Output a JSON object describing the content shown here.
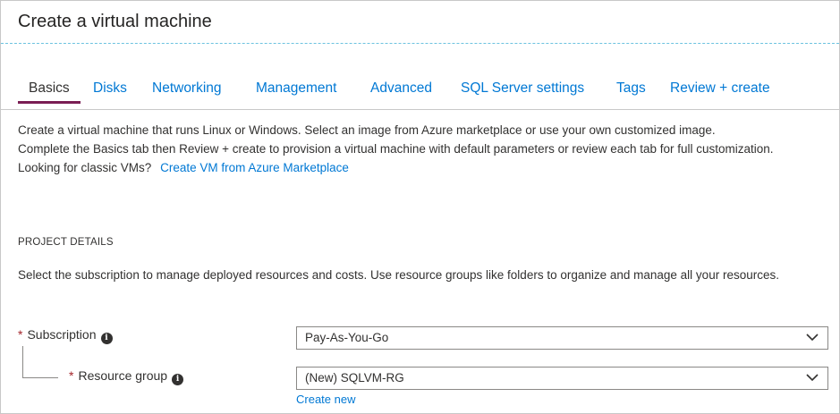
{
  "page": {
    "title": "Create a virtual machine"
  },
  "tabs": [
    {
      "label": "Basics",
      "active": true
    },
    {
      "label": "Disks",
      "active": false
    },
    {
      "label": "Networking",
      "active": false
    },
    {
      "label": "Management",
      "active": false
    },
    {
      "label": "Advanced",
      "active": false
    },
    {
      "label": "SQL Server settings",
      "active": false
    },
    {
      "label": "Tags",
      "active": false
    },
    {
      "label": "Review + create",
      "active": false
    }
  ],
  "intro": {
    "line1": "Create a virtual machine that runs Linux or Windows. Select an image from Azure marketplace or use your own customized image.",
    "line2": "Complete the Basics tab then Review + create to provision a virtual machine with default parameters or review each tab for full customization.",
    "classic_prompt": "Looking for classic VMs?",
    "classic_link": "Create VM from Azure Marketplace"
  },
  "project_details": {
    "heading": "PROJECT DETAILS",
    "description": "Select the subscription to manage deployed resources and costs. Use resource groups like folders to organize and manage all your resources."
  },
  "form": {
    "required_marker": "*",
    "info_glyph": "i",
    "subscription": {
      "label": "Subscription",
      "value": "Pay-As-You-Go"
    },
    "resource_group": {
      "label": "Resource group",
      "value": "(New) SQLVM-RG",
      "create_new": "Create new"
    }
  },
  "colors": {
    "link": "#0078d4",
    "active_tab_underline": "#7a1e54",
    "required": "#a4262c",
    "header_divider": "#6cc3e0"
  },
  "icons": {
    "info": "info-icon",
    "dropdown": "chevron-down-icon"
  }
}
